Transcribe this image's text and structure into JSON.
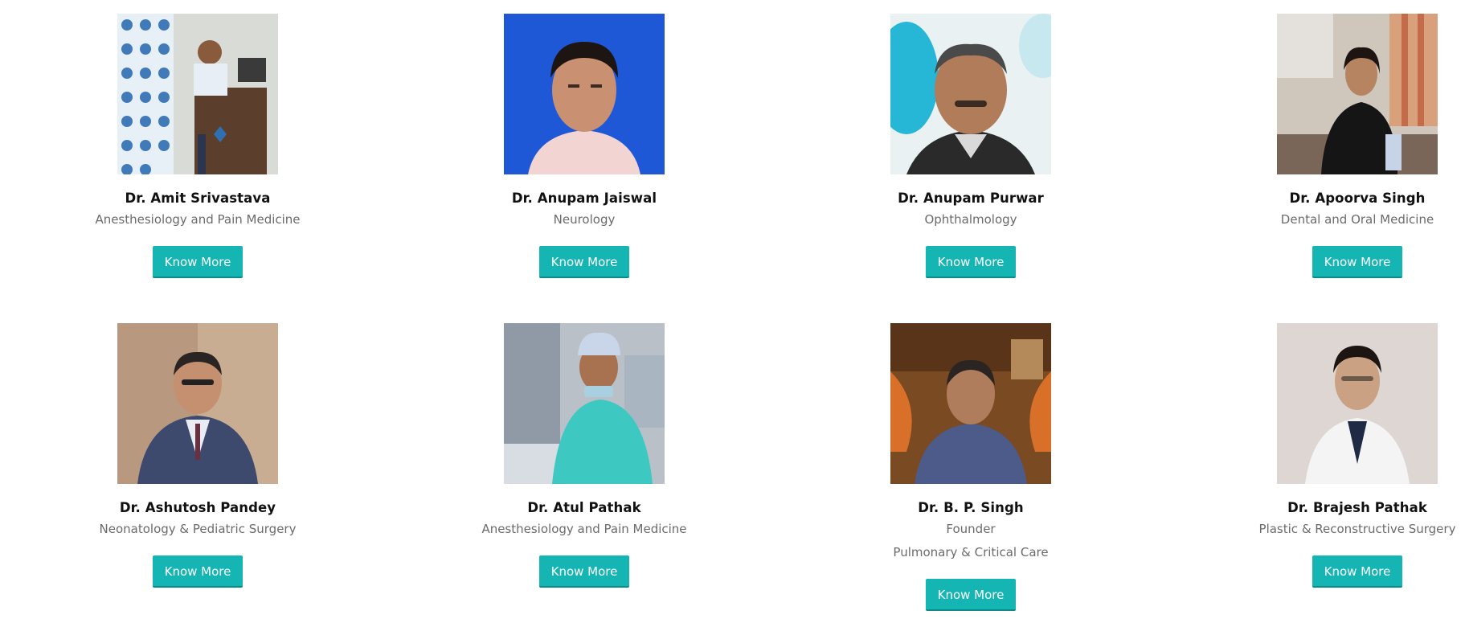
{
  "doctors": [
    {
      "name": "Dr. Amit Srivastava",
      "specialty": "Anesthesiology and Pain Medicine",
      "button": "Know More"
    },
    {
      "name": "Dr. Anupam Jaiswal",
      "specialty": "Neurology",
      "button": "Know More"
    },
    {
      "name": "Dr. Anupam Purwar",
      "specialty": "Ophthalmology",
      "button": "Know More"
    },
    {
      "name": "Dr. Apoorva Singh",
      "specialty": "Dental and Oral Medicine",
      "button": "Know More"
    },
    {
      "name": "Dr. Ashutosh Pandey",
      "specialty": "Neonatology & Pediatric Surgery",
      "button": "Know More"
    },
    {
      "name": "Dr. Atul Pathak",
      "specialty": "Anesthesiology and Pain Medicine",
      "button": "Know More"
    },
    {
      "name": "Dr. B. P. Singh",
      "specialty": "Founder",
      "specialty2": "Pulmonary & Critical Care",
      "button": "Know More"
    },
    {
      "name": "Dr. Brajesh Pathak",
      "specialty": "Plastic & Reconstructive Surgery",
      "button": "Know More"
    }
  ],
  "colors": {
    "button_bg": "#15b5b3",
    "button_text": "#ffffff"
  }
}
